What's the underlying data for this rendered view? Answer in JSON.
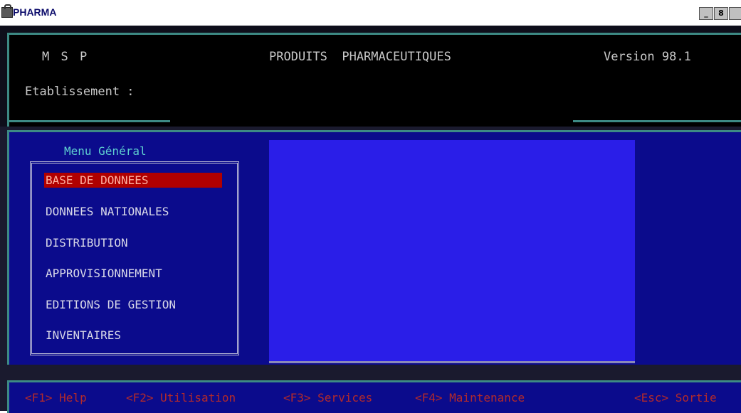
{
  "window": {
    "title": "PHARMA",
    "controls": {
      "minimize": "_",
      "restore": "8"
    }
  },
  "header": {
    "org": "M S P",
    "product": "PRODUITS  PHARMACEUTIQUES",
    "version": "Version 98.1",
    "etablissement_label": "Etablissement :"
  },
  "menu": {
    "title": "Menu Général",
    "items": [
      {
        "label": "BASE DE DONNEES",
        "selected": true
      },
      {
        "label": "DONNEES NATIONALES",
        "selected": false
      },
      {
        "label": "DISTRIBUTION",
        "selected": false
      },
      {
        "label": "APPROVISIONNEMENT",
        "selected": false
      },
      {
        "label": "EDITIONS DE GESTION",
        "selected": false
      },
      {
        "label": "INVENTAIRES",
        "selected": false
      }
    ]
  },
  "function_keys": [
    {
      "label": "<F1> Help"
    },
    {
      "label": "<F2> Utilisation"
    },
    {
      "label": "<F3> Services"
    },
    {
      "label": "<F4> Maintenance"
    },
    {
      "label": "<Esc> Sortie"
    }
  ],
  "colors": {
    "screen_blue": "#0b0b8c",
    "panel_blue": "#2a1ee8",
    "frame_teal": "#3d8a84",
    "selection_red": "#b00000",
    "fkey_red": "#b42a2a",
    "menu_title_cyan": "#5fd0d0"
  }
}
